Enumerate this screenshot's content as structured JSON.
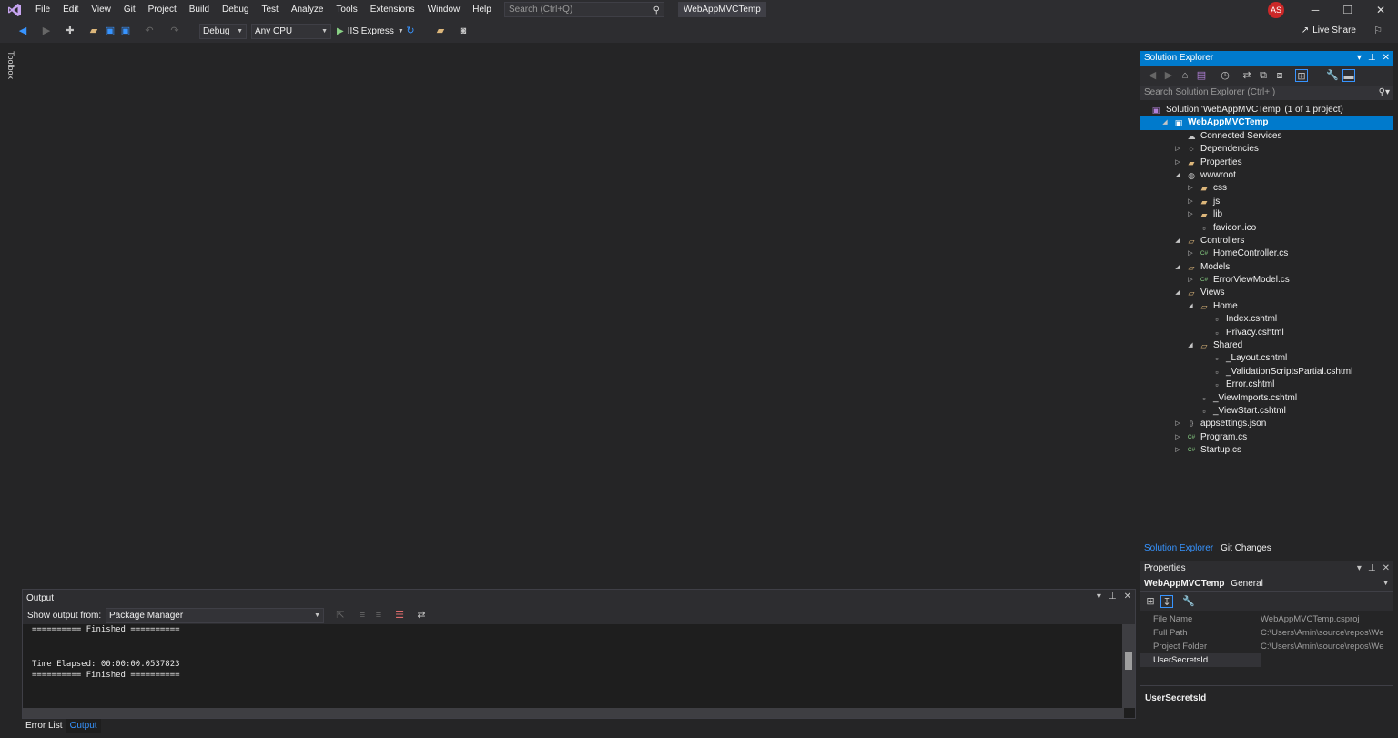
{
  "menubar": {
    "items": [
      "File",
      "Edit",
      "View",
      "Git",
      "Project",
      "Build",
      "Debug",
      "Test",
      "Analyze",
      "Tools",
      "Extensions",
      "Window",
      "Help"
    ],
    "search_placeholder": "Search (Ctrl+Q)",
    "solution_title": "WebAppMVCTemp",
    "avatar_initials": "AS"
  },
  "toolbar": {
    "config": "Debug",
    "platform": "Any CPU",
    "run_target": "IIS Express",
    "live_share": "Live Share"
  },
  "toolbox": {
    "label": "Toolbox"
  },
  "output": {
    "title": "Output",
    "show_from_label": "Show output from:",
    "source": "Package Manager",
    "lines": [
      "========== Finished ==========",
      "",
      "",
      "Time Elapsed: 00:00:00.0537823",
      "========== Finished =========="
    ]
  },
  "bottom_tabs": [
    "Error List",
    "Output"
  ],
  "solution_explorer": {
    "title": "Solution Explorer",
    "search_placeholder": "Search Solution Explorer (Ctrl+;)",
    "tree": [
      {
        "label": "Solution 'WebAppMVCTemp' (1 of 1 project)",
        "depth": 0,
        "expander": "",
        "icon": "solution-icon"
      },
      {
        "label": "WebAppMVCTemp",
        "depth": 0,
        "expander": "◢",
        "icon": "project-icon",
        "selected": true
      },
      {
        "label": "Connected Services",
        "depth": 1,
        "expander": "",
        "icon": "connected-services-icon"
      },
      {
        "label": "Dependencies",
        "depth": 1,
        "expander": "▷",
        "icon": "dependencies-icon"
      },
      {
        "label": "Properties",
        "depth": 1,
        "expander": "▷",
        "icon": "folder-icon"
      },
      {
        "label": "wwwroot",
        "depth": 1,
        "expander": "◢",
        "icon": "globe-icon"
      },
      {
        "label": "css",
        "depth": 2,
        "expander": "▷",
        "icon": "folder-icon"
      },
      {
        "label": "js",
        "depth": 2,
        "expander": "▷",
        "icon": "folder-icon"
      },
      {
        "label": "lib",
        "depth": 2,
        "expander": "▷",
        "icon": "folder-icon"
      },
      {
        "label": "favicon.ico",
        "depth": 2,
        "expander": "",
        "icon": "file-icon"
      },
      {
        "label": "Controllers",
        "depth": 1,
        "expander": "◢",
        "icon": "folder-open-icon"
      },
      {
        "label": "HomeController.cs",
        "depth": 2,
        "expander": "▷",
        "icon": "csharp-file-icon"
      },
      {
        "label": "Models",
        "depth": 1,
        "expander": "◢",
        "icon": "folder-open-icon"
      },
      {
        "label": "ErrorViewModel.cs",
        "depth": 2,
        "expander": "▷",
        "icon": "csharp-file-icon"
      },
      {
        "label": "Views",
        "depth": 1,
        "expander": "◢",
        "icon": "folder-open-icon"
      },
      {
        "label": "Home",
        "depth": 2,
        "expander": "◢",
        "icon": "folder-open-icon"
      },
      {
        "label": "Index.cshtml",
        "depth": 3,
        "expander": "",
        "icon": "razor-file-icon"
      },
      {
        "label": "Privacy.cshtml",
        "depth": 3,
        "expander": "",
        "icon": "razor-file-icon"
      },
      {
        "label": "Shared",
        "depth": 2,
        "expander": "◢",
        "icon": "folder-open-icon"
      },
      {
        "label": "_Layout.cshtml",
        "depth": 3,
        "expander": "",
        "icon": "razor-file-icon"
      },
      {
        "label": "_ValidationScriptsPartial.cshtml",
        "depth": 3,
        "expander": "",
        "icon": "razor-file-icon"
      },
      {
        "label": "Error.cshtml",
        "depth": 3,
        "expander": "",
        "icon": "razor-file-icon"
      },
      {
        "label": "_ViewImports.cshtml",
        "depth": 2,
        "expander": "",
        "icon": "razor-file-icon"
      },
      {
        "label": "_ViewStart.cshtml",
        "depth": 2,
        "expander": "",
        "icon": "razor-file-icon"
      },
      {
        "label": "appsettings.json",
        "depth": 1,
        "expander": "▷",
        "icon": "json-file-icon"
      },
      {
        "label": "Program.cs",
        "depth": 1,
        "expander": "▷",
        "icon": "csharp-file-icon"
      },
      {
        "label": "Startup.cs",
        "depth": 1,
        "expander": "▷",
        "icon": "csharp-file-icon"
      }
    ],
    "tabs": [
      "Solution Explorer",
      "Git Changes"
    ]
  },
  "properties": {
    "title": "Properties",
    "object_name": "WebAppMVCTemp",
    "object_type": "General",
    "rows": [
      {
        "key": "File Name",
        "value": "WebAppMVCTemp.csproj"
      },
      {
        "key": "Full Path",
        "value": "C:\\Users\\Amin\\source\\repos\\We"
      },
      {
        "key": "Project Folder",
        "value": "C:\\Users\\Amin\\source\\repos\\We"
      },
      {
        "key": "UserSecretsId",
        "value": ""
      }
    ],
    "description_title": "UserSecretsId"
  },
  "colors": {
    "accent": "#007acc",
    "background": "#252526",
    "chrome": "#2d2d30",
    "avatar": "#cc2828"
  }
}
